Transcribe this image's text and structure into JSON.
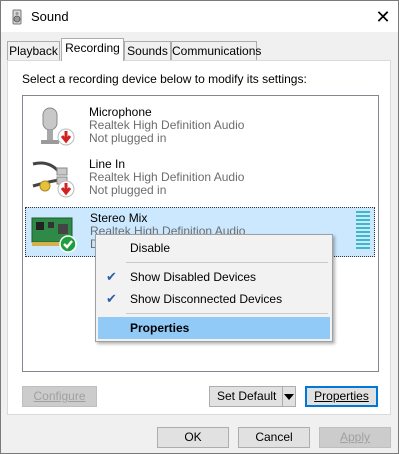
{
  "window": {
    "title": "Sound",
    "close_label": "✕"
  },
  "tabs": [
    {
      "label": "Playback"
    },
    {
      "label": "Recording"
    },
    {
      "label": "Sounds"
    },
    {
      "label": "Communications"
    }
  ],
  "instruction": "Select a recording device below to modify its settings:",
  "devices": [
    {
      "name": "Microphone",
      "description": "Realtek High Definition Audio",
      "status": "Not plugged in",
      "icon": "microphone-icon",
      "badge": "red-down-arrow"
    },
    {
      "name": "Line In",
      "description": "Realtek High Definition Audio",
      "status": "Not plugged in",
      "icon": "line-in-cable-icon",
      "badge": "red-down-arrow"
    },
    {
      "name": "Stereo Mix",
      "description": "Realtek High Definition Audio",
      "status": "D",
      "icon": "sound-card-icon",
      "badge": "green-check",
      "selected": true
    }
  ],
  "context_menu": {
    "items": [
      {
        "label": "Disable",
        "checked": false
      },
      {
        "label": "Show Disabled Devices",
        "checked": true
      },
      {
        "label": "Show Disconnected Devices",
        "checked": true
      },
      {
        "label": "Properties",
        "highlighted": true,
        "bold": true
      }
    ]
  },
  "panel_buttons": {
    "configure": "Configure",
    "set_default": "Set Default",
    "properties": "Properties"
  },
  "dialog_buttons": {
    "ok": "OK",
    "cancel": "Cancel",
    "apply": "Apply"
  },
  "colors": {
    "selection": "#cce8ff",
    "menu_highlight": "#91c9f7",
    "level_meter": "#3cb8c7"
  }
}
